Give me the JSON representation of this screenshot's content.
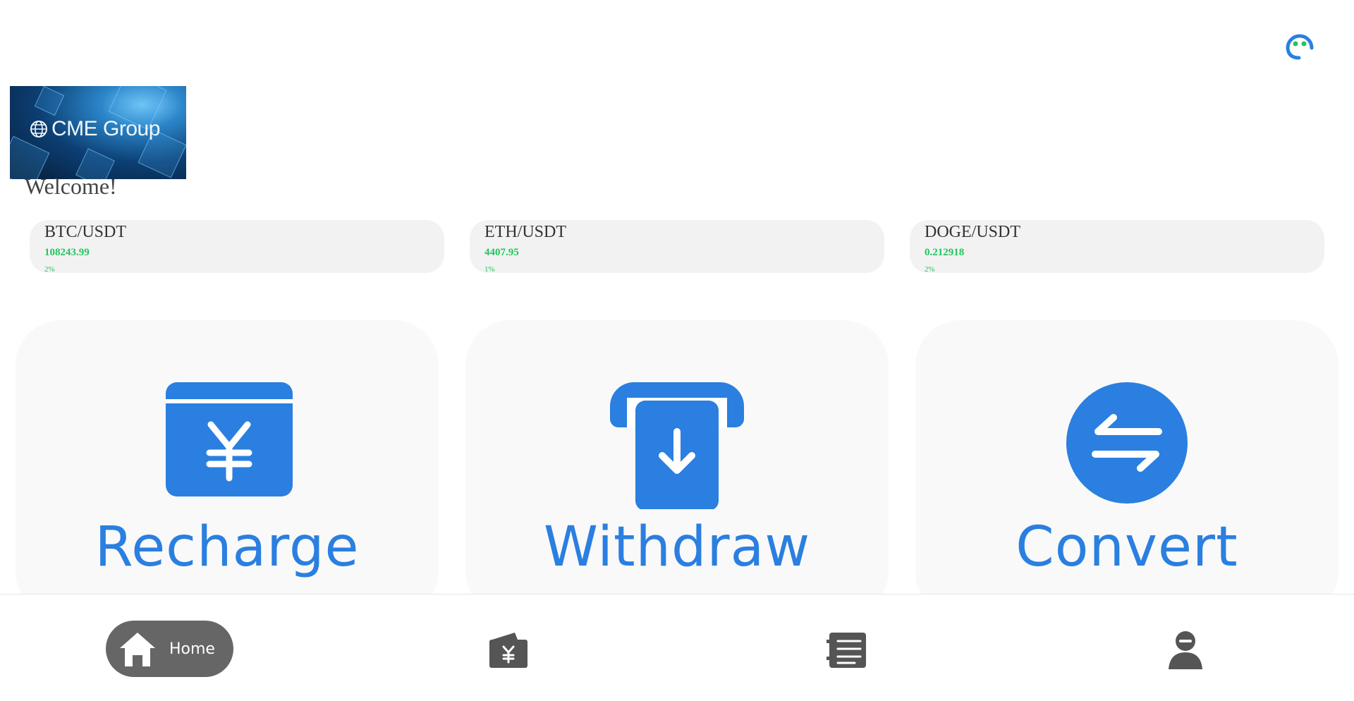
{
  "header": {
    "support_icon": "customer-service-headset-icon"
  },
  "banner": {
    "brand_text": "CME Group",
    "brand_icon": "globe-icon"
  },
  "welcome_text": "Welcome!",
  "tickers": [
    {
      "pair": "BTC/USDT",
      "price": "108243.99",
      "change": "2%"
    },
    {
      "pair": "ETH/USDT",
      "price": "4407.95",
      "change": "1%"
    },
    {
      "pair": "DOGE/USDT",
      "price": "0.212918",
      "change": "2%"
    }
  ],
  "actions": [
    {
      "label": "Recharge",
      "icon": "wallet-yen-icon"
    },
    {
      "label": "Withdraw",
      "icon": "atm-withdraw-icon"
    },
    {
      "label": "Convert",
      "icon": "exchange-arrows-icon"
    }
  ],
  "nav": {
    "home_label": "Home",
    "items": [
      "home-icon",
      "wallet-yen-icon",
      "list-icon",
      "profile-icon"
    ]
  },
  "colors": {
    "accent_blue": "#2a7fe0",
    "up_green": "#22c55e",
    "nav_active_bg": "#666666",
    "card_bg": "#f2f2f2"
  }
}
